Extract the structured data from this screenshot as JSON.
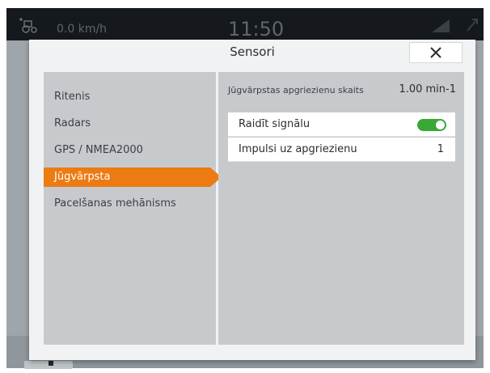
{
  "status_bar": {
    "speed": "0.0 km/h",
    "time": "11:50",
    "icons": [
      "tractor-icon",
      "signal-strength-icon",
      "gps-icon"
    ]
  },
  "dialog": {
    "title": "Sensori",
    "close_icon": "close-icon"
  },
  "nav": {
    "items": [
      {
        "label": "Ritenis",
        "active": false
      },
      {
        "label": "Radars",
        "active": false
      },
      {
        "label": "GPS / NMEA2000",
        "active": false
      },
      {
        "label": "Jūgvārpsta",
        "active": true
      },
      {
        "label": "Pacelšanas mehānisms",
        "active": false
      }
    ]
  },
  "detail": {
    "rpm_label": "Jūgvārpstas apgriezienu skaits",
    "rpm_value": "1.00 min-1",
    "signal_label": "Raidīt signālu",
    "signal_on": true,
    "pulses_label": "Impulsi uz apgriezienu",
    "pulses_value": "1"
  },
  "colors": {
    "accent": "#ec7b13",
    "toggle_on": "#39a935",
    "panel": "#c7cacd"
  }
}
